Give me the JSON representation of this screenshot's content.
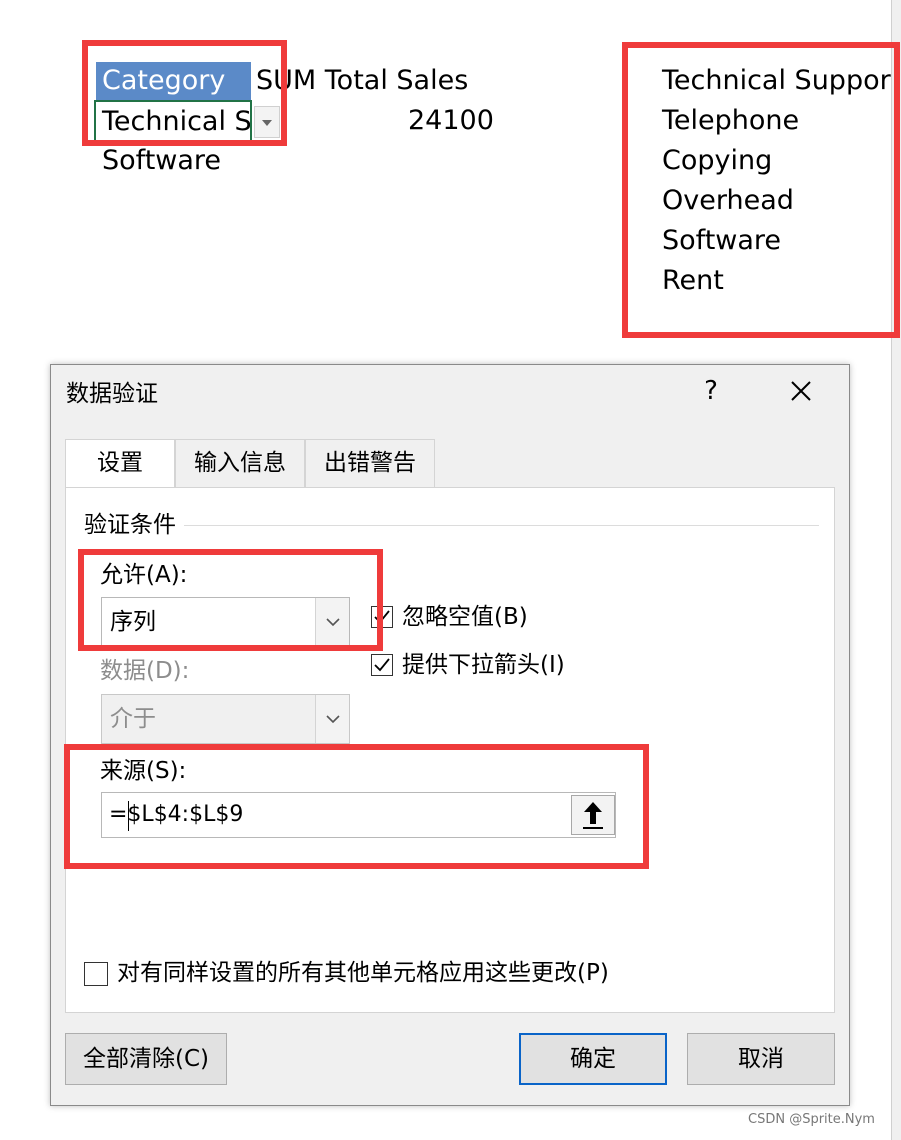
{
  "sheet": {
    "header_category": "Category",
    "header_sum": "SUM Total Sales",
    "selected_cell_value": "Technical S",
    "sum_value": "24100",
    "row3_value": "Software",
    "list_items": [
      "Technical Suppor",
      "Telephone",
      "Copying",
      "Overhead",
      "Software",
      "Rent"
    ]
  },
  "dialog": {
    "title": "数据验证",
    "help": "?",
    "tabs": [
      "设置",
      "输入信息",
      "出错警告"
    ],
    "section_title": "验证条件",
    "allow_label": "允许(A):",
    "allow_value": "序列",
    "data_label": "数据(D):",
    "data_value": "介于",
    "ignore_blank": "忽略空值(B)",
    "dropdown_arrow": "提供下拉箭头(I)",
    "source_label": "来源(S):",
    "source_value": "=$L$4:$L$9",
    "apply_all": "对有同样设置的所有其他单元格应用这些更改(P)",
    "clear_all": "全部清除(C)",
    "ok": "确定",
    "cancel": "取消"
  },
  "watermark": "CSDN @Sprite.Nym",
  "colors": {
    "highlight": "#ef3b3b",
    "header_fill": "#5b8ac8",
    "focus": "#0a64c8",
    "cell_border": "#217346"
  }
}
